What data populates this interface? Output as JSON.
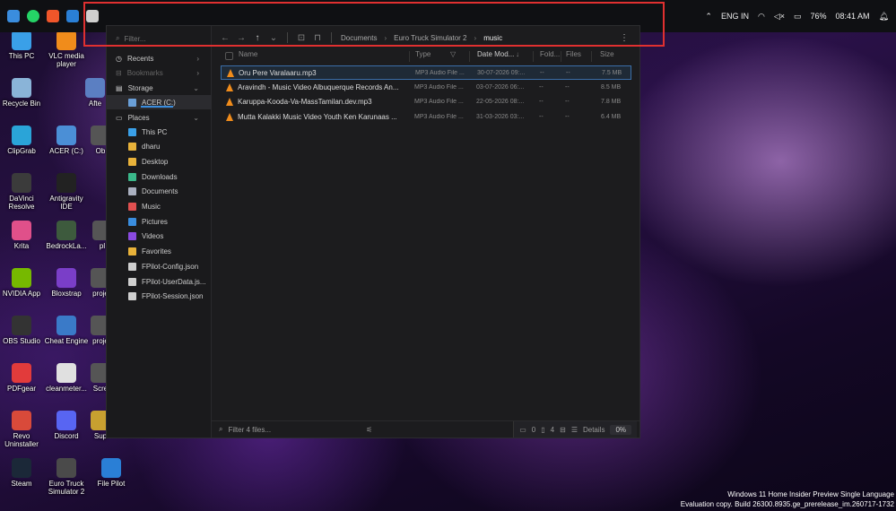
{
  "taskbar": {
    "language": "ENG IN",
    "battery": "76%",
    "time": "08:41 AM"
  },
  "desktop_icons": [
    {
      "label": "This PC",
      "color": "#3aa0e8"
    },
    {
      "label": "VLC media player",
      "color": "#f08c1b"
    },
    {
      "label": "Recycle Bin",
      "color": "#8ab4d8"
    },
    {
      "label": "Afte",
      "color": "#5b7fc2"
    },
    {
      "label": "ClipGrab",
      "color": "#2aa4d8"
    },
    {
      "label": "ACER (C:)",
      "color": "#4b8fd6"
    },
    {
      "label": "Ob",
      "color": "#555555"
    },
    {
      "label": "DaVinci Resolve",
      "color": "#3b3b3b"
    },
    {
      "label": "Antigravity IDE",
      "color": "#222222"
    },
    {
      "label": "Krita",
      "color": "#e0508a"
    },
    {
      "label": "BedrockLa...",
      "color": "#3d5a3d"
    },
    {
      "label": "pl",
      "color": "#555555"
    },
    {
      "label": "NVIDIA App",
      "color": "#76b900"
    },
    {
      "label": "Bloxstrap",
      "color": "#7a3ec8"
    },
    {
      "label": "proje",
      "color": "#555555"
    },
    {
      "label": "OBS Studio",
      "color": "#333333"
    },
    {
      "label": "Cheat Engine",
      "color": "#3a7ac8"
    },
    {
      "label": "proje",
      "color": "#555555"
    },
    {
      "label": "PDFgear",
      "color": "#e23b3b"
    },
    {
      "label": "cleanmeter...",
      "color": "#e0e0e0"
    },
    {
      "label": "Scre",
      "color": "#555555"
    },
    {
      "label": "Revo Uninstaller",
      "color": "#d94a3a"
    },
    {
      "label": "Discord",
      "color": "#5865f2"
    },
    {
      "label": "Sup",
      "color": "#c8a030"
    },
    {
      "label": "Steam",
      "color": "#1b2838"
    },
    {
      "label": "Euro Truck Simulator 2",
      "color": "#4a4a4a"
    },
    {
      "label": "File Pilot",
      "color": "#2a7fd6"
    }
  ],
  "window": {
    "filter_placeholder": "Filter...",
    "sidebar": {
      "recents": "Recents",
      "bookmarks": "Bookmarks",
      "storage": "Storage",
      "drive": "ACER (C:)",
      "places": "Places",
      "items": [
        {
          "label": "This PC",
          "icon": "computer-icon",
          "color": "#3aa0e8"
        },
        {
          "label": "dharu",
          "icon": "folder-icon",
          "color": "#e8b23a"
        },
        {
          "label": "Desktop",
          "icon": "folder-icon",
          "color": "#e8b23a"
        },
        {
          "label": "Downloads",
          "icon": "download-icon",
          "color": "#3ab88a"
        },
        {
          "label": "Documents",
          "icon": "document-icon",
          "color": "#aab0c0"
        },
        {
          "label": "Music",
          "icon": "music-icon",
          "color": "#e05050"
        },
        {
          "label": "Pictures",
          "icon": "picture-icon",
          "color": "#3a8dde"
        },
        {
          "label": "Videos",
          "icon": "video-icon",
          "color": "#8a4ae0"
        },
        {
          "label": "Favorites",
          "icon": "folder-icon",
          "color": "#e8b23a"
        },
        {
          "label": "FPilot-Config.json",
          "icon": "file-icon",
          "color": "#cfcfcf"
        },
        {
          "label": "FPilot-UserData.js...",
          "icon": "file-icon",
          "color": "#cfcfcf"
        },
        {
          "label": "FPilot-Session.json",
          "icon": "file-icon",
          "color": "#cfcfcf"
        }
      ]
    },
    "breadcrumb": [
      "Documents",
      "Euro Truck Simulator 2",
      "music"
    ],
    "columns": {
      "name": "Name",
      "type": "Type",
      "date": "Date Mod...",
      "folders": "Fold...",
      "files": "Files",
      "size": "Size"
    },
    "files": [
      {
        "name": "Oru Pere Varalaaru.mp3",
        "type": "MP3 Audio File ...",
        "date": "30-07-2026 09:...",
        "folders": "--",
        "files": "--",
        "size": "7.5 MB"
      },
      {
        "name": "Aravindh - Music Video  Albuquerque Records  An...",
        "type": "MP3 Audio File ...",
        "date": "03-07-2026 06:...",
        "folders": "--",
        "files": "--",
        "size": "8.5 MB"
      },
      {
        "name": "Karuppa-Kooda-Va-MassTamilan.dev.mp3",
        "type": "MP3 Audio File ...",
        "date": "22-05-2026 08:...",
        "folders": "--",
        "files": "--",
        "size": "7.8 MB"
      },
      {
        "name": "Mutta Kalakki Music Video  Youth  Ken Karunaas ...",
        "type": "MP3 Audio File ...",
        "date": "31-03-2026 03:...",
        "folders": "--",
        "files": "--",
        "size": "6.4 MB"
      }
    ],
    "status": {
      "filter_placeholder": "Filter 4 files...",
      "folder_count": "0",
      "file_count": "4",
      "view_label": "Details",
      "percent": "0%"
    }
  },
  "watermark": {
    "line1": "Windows 11 Home Insider Preview Single Language",
    "line2": "Evaluation copy. Build 26300.8935.ge_prerelease_im.260717-1732"
  }
}
